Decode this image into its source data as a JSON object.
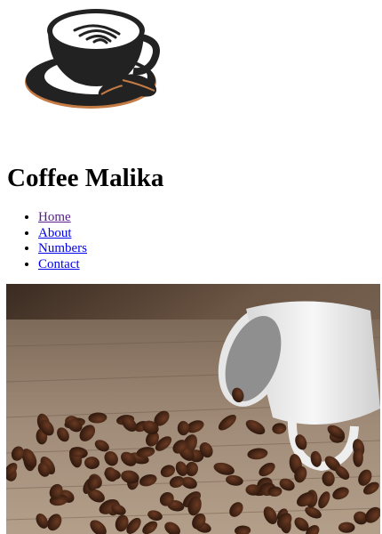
{
  "site": {
    "title": "Coffee Malika"
  },
  "logo": {
    "icon": "coffee-cup-with-beans-logo",
    "colors": {
      "ink": "#222222",
      "accent": "#c47a45"
    }
  },
  "nav": {
    "items": [
      {
        "label": "Home",
        "visited": true
      },
      {
        "label": "About",
        "visited": false
      },
      {
        "label": "Numbers",
        "visited": false
      },
      {
        "label": "Contact",
        "visited": false
      }
    ]
  },
  "hero": {
    "subject": "white-cup-with-spilled-coffee-beans-on-wood"
  },
  "colors": {
    "link": "#0000ee",
    "visited_link": "#551a8b"
  }
}
